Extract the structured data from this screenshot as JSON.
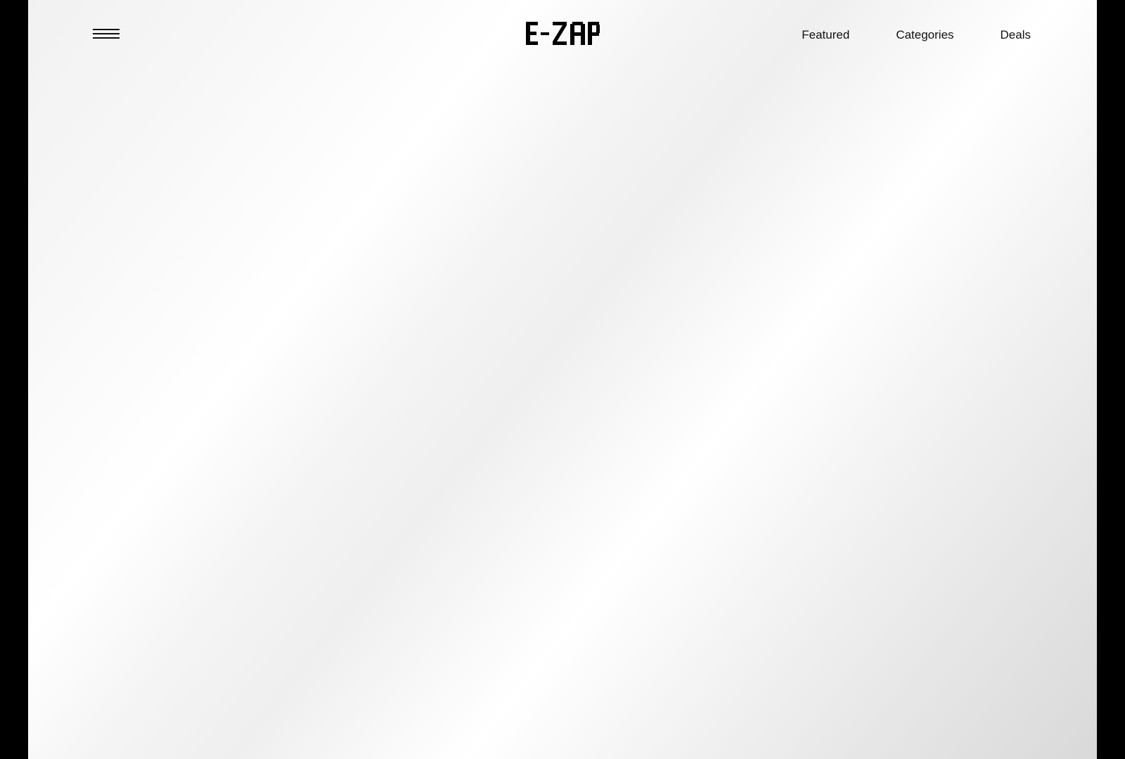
{
  "header": {
    "brand": "E-ZAP",
    "nav": [
      {
        "label": "Featured"
      },
      {
        "label": "Categories"
      },
      {
        "label": "Deals"
      }
    ]
  },
  "icons": {
    "menu": "menu-icon"
  },
  "colors": {
    "outer_background": "#000000",
    "text": "#111111"
  }
}
